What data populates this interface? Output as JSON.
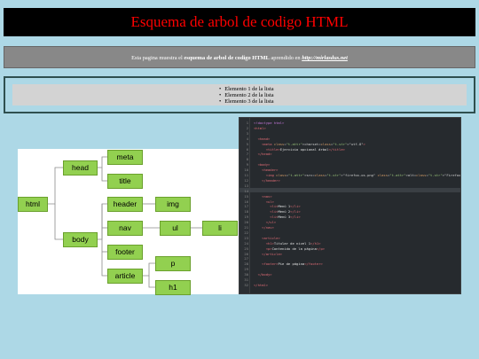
{
  "header": {
    "title": "Esquema de arbol de codigo HTML"
  },
  "intro": {
    "text_before": "Esta pagina muestra el ",
    "bold": "esquema de arbol de codigo HTML",
    "text_middle": " aprendido en ",
    "link": "http://mirlasdus.net"
  },
  "list": {
    "items": [
      "Elemento 1 de la lista",
      "Elemento 2 de la lista",
      "Elemento 3 de la lista"
    ]
  },
  "tree": {
    "nodes": {
      "html": "html",
      "head": "head",
      "meta": "meta",
      "title": "title",
      "body": "body",
      "header": "header",
      "img": "img",
      "nav": "nav",
      "ul": "ul",
      "li": "li",
      "footer": "footer",
      "article": "article",
      "p": "p",
      "h1": "h1"
    }
  },
  "code": {
    "highlighted_line": 14,
    "lines": [
      "<!doctype html>",
      "<html>",
      "",
      "  <head>",
      "    <meta charset=\"utf-8\">",
      "      <title>Ejercicio opcional árbol</title>",
      "  </head>",
      "",
      "  <body>",
      "    <header>",
      "      <img src=\"firefox-os.png\" alt=\"FirefoxOS Logo\" width=\"200\" height=\"164\">",
      "    </header>",
      "",
      "",
      "    <nav>",
      "      <ul>",
      "        <li>Menú 1</li>",
      "        <li>Menú 2</li>",
      "        <li>Menú 3</li>",
      "      </ul>",
      "    </nav>",
      "",
      "    <article>",
      "      <h1>Titular de nivel 1</h1>",
      "      <p>Contenido de la página</p>",
      "    </article>",
      "",
      "    <footer>Pie de página</footer>",
      "",
      "  </body>",
      "",
      "</html>"
    ]
  },
  "colors": {
    "page_bg": "#add8e6",
    "header_bg": "#000000",
    "header_text": "#ff0000",
    "node_fill": "#92d050",
    "code_bg": "#262a2e"
  }
}
